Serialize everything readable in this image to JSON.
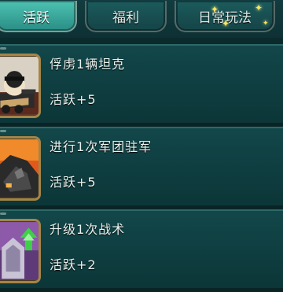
{
  "tabs": [
    {
      "label": "活跃",
      "active": true
    },
    {
      "label": "福利",
      "active": false
    },
    {
      "label": "日常玩法",
      "active": false
    }
  ],
  "tasks": [
    {
      "title": "俘虏1辆坦克",
      "reward": "活跃+5",
      "icon": "tank-commander-icon"
    },
    {
      "title": "进行1次军团驻军",
      "reward": "活跃+5",
      "icon": "fortress-icon"
    },
    {
      "title": "升级1次战术",
      "reward": "活跃+2",
      "icon": "tactic-upgrade-icon"
    }
  ],
  "colors": {
    "active_tab": "#3fb0a3",
    "row_bg": "#12474a",
    "icon_frame": "#a48548",
    "sparkle": "#ffe65a"
  }
}
